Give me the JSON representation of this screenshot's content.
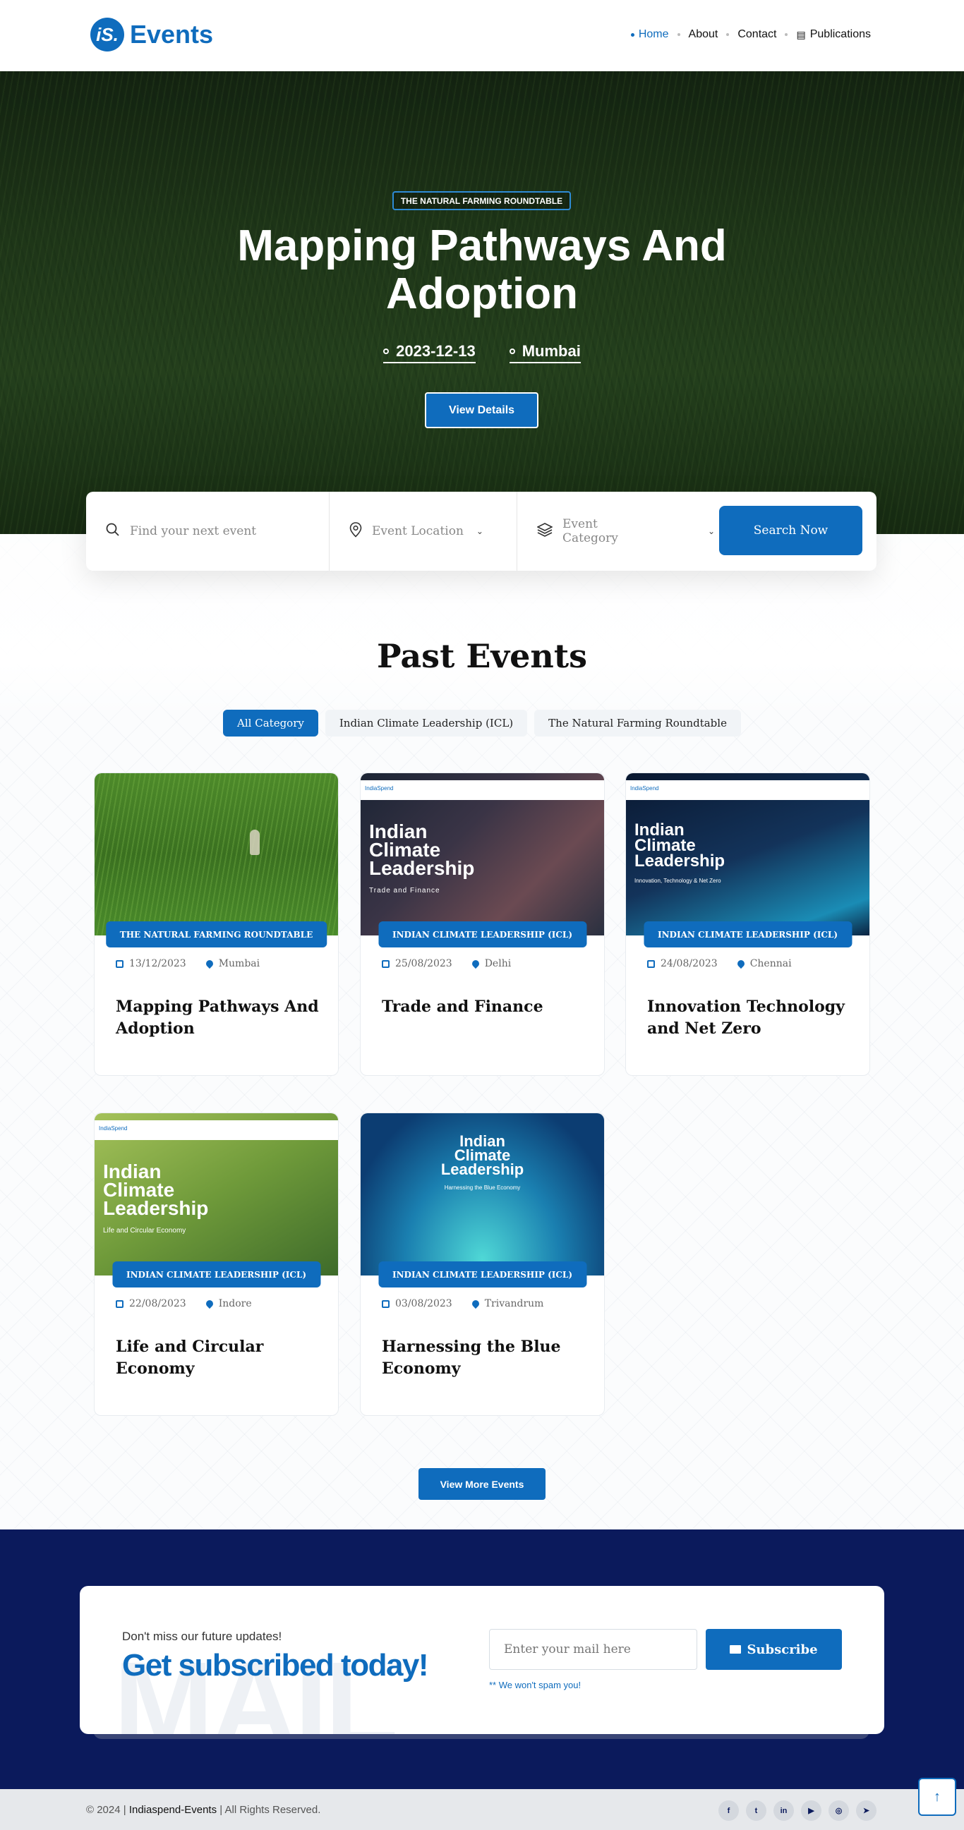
{
  "brand": {
    "logo_mark": "iS.",
    "logo_text": "Events",
    "accent": "#0f6cbd",
    "dark_navy": "#0b1a5c"
  },
  "nav": {
    "items": [
      {
        "label": "Home",
        "active": true
      },
      {
        "label": "About"
      },
      {
        "label": "Contact"
      },
      {
        "label": "Publications",
        "icon": "newspaper-icon"
      }
    ]
  },
  "hero": {
    "badge": "THE NATURAL FARMING ROUNDTABLE",
    "title": "Mapping Pathways And Adoption",
    "date": "2023-12-13",
    "location": "Mumbai",
    "button": "View Details"
  },
  "search": {
    "keyword_placeholder": "Find your next event",
    "location_placeholder": "Event Location",
    "category_placeholder": "Event Category",
    "button": "Search Now"
  },
  "past_events": {
    "title": "Past Events",
    "filters": [
      {
        "label": "All Category",
        "active": true
      },
      {
        "label": "Indian Climate Leadership (ICL)"
      },
      {
        "label": "The Natural Farming Roundtable"
      }
    ],
    "cards": [
      {
        "category": "THE NATURAL FARMING ROUNDTABLE",
        "date": "13/12/2023",
        "location": "Mumbai",
        "title": "Mapping Pathways And Adoption"
      },
      {
        "category": "INDIAN CLIMATE LEADERSHIP (ICL)",
        "date": "25/08/2023",
        "location": "Delhi",
        "title": "Trade and Finance",
        "image_heading": "Indian Climate Leadership",
        "image_sub": "Trade and Finance"
      },
      {
        "category": "INDIAN CLIMATE LEADERSHIP (ICL)",
        "date": "24/08/2023",
        "location": "Chennai",
        "title": "Innovation Technology and Net Zero",
        "image_heading": "Indian Climate Leadership",
        "image_sub": "Innovation, Technology & Net Zero"
      },
      {
        "category": "INDIAN CLIMATE LEADERSHIP (ICL)",
        "date": "22/08/2023",
        "location": "Indore",
        "title": "Life and Circular Economy",
        "image_heading": "Indian Climate Leadership",
        "image_sub": "Life and Circular Economy"
      },
      {
        "category": "INDIAN CLIMATE LEADERSHIP (ICL)",
        "date": "03/08/2023",
        "location": "Trivandrum",
        "title": "Harnessing the Blue Economy",
        "image_heading": "Indian Climate Leadership",
        "image_sub": "Harnessing the Blue Economy"
      }
    ],
    "image_strip_label": "IndiaSpend",
    "view_more": "View More Events"
  },
  "subscribe": {
    "watermark": "MAIL",
    "small": "Don't miss our future updates!",
    "big": "Get subscribed today!",
    "placeholder": "Enter your mail here",
    "button": "Subscribe",
    "note": "** We won't spam you!"
  },
  "footer": {
    "copyright": "© 2024 |",
    "site": "Indiaspend-Events",
    "rights": "| All Rights Reserved.",
    "socials": [
      "f",
      "t",
      "in",
      "▶",
      "◎",
      "➤"
    ]
  },
  "back_to_top": "↑"
}
